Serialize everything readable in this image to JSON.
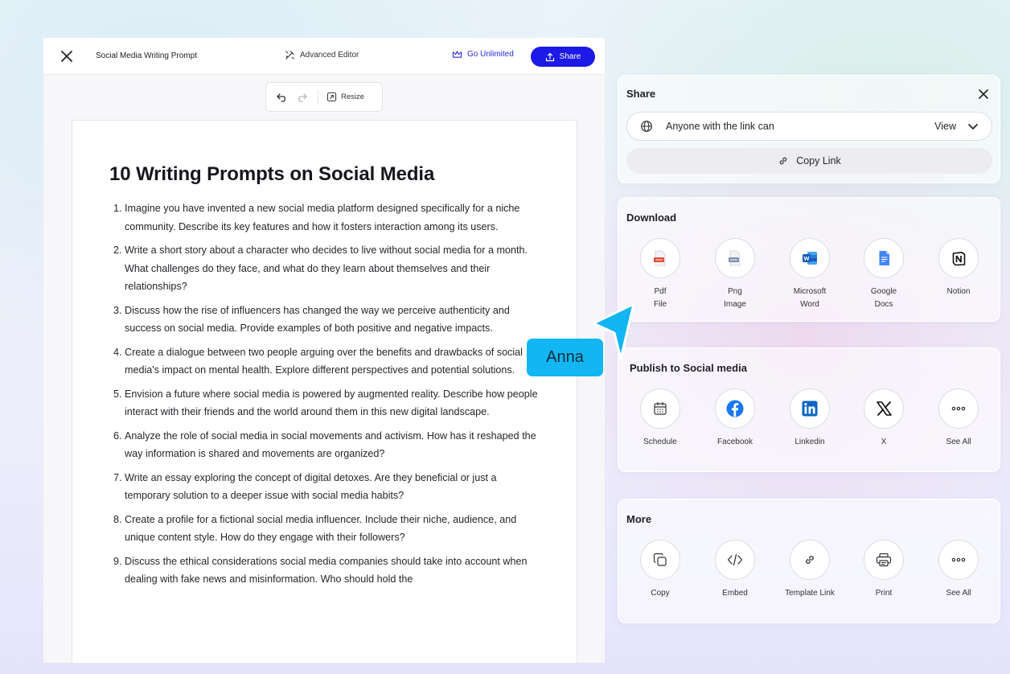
{
  "topbar": {
    "doc_title": "Social Media Writing Prompt",
    "advanced_editor": "Advanced Editor",
    "go_unlimited": "Go Unlimited",
    "share": "Share"
  },
  "toolbar": {
    "resize": "Resize"
  },
  "document": {
    "title": "10 Writing Prompts on Social Media",
    "prompts": [
      "Imagine you have invented a new social media platform designed specifically for a niche community. Describe its key features and how it fosters interaction among its users.",
      "Write a short story about a character who decides to live without social media for a month. What challenges do they face, and what do they learn about themselves and their relationships?",
      "Discuss how the rise of influencers has changed the way we perceive authenticity and success on social media. Provide examples of both positive and negative impacts.",
      "Create a dialogue between two people arguing over the benefits and drawbacks of social media's impact on mental health. Explore different perspectives and potential solutions.",
      "Envision a future where social media is powered by augmented reality. Describe how people interact with their friends and the world around them in this new digital landscape.",
      "Analyze the role of social media in social movements and activism. How has it reshaped the way information is shared and movements are organized?",
      "Write an essay exploring the concept of digital detoxes. Are they beneficial or just a temporary solution to a deeper issue with social media habits?",
      "Create a profile for a fictional social media influencer. Include their niche, audience, and unique content style. How do they engage with their followers?",
      "Discuss the ethical considerations social media companies should take into account when dealing with fake news and misinformation. Who should hold the"
    ]
  },
  "share_panel": {
    "title": "Share",
    "access_text": "Anyone with the link can",
    "access_level": "View",
    "copy_link": "Copy Link"
  },
  "download": {
    "title": "Download",
    "options": [
      {
        "label": "Pdf\nFile",
        "icon": "pdf-file-icon"
      },
      {
        "label": "Png\nImage",
        "icon": "png-image-icon"
      },
      {
        "label": "Microsoft\nWord",
        "icon": "microsoft-word-icon"
      },
      {
        "label": "Google\nDocs",
        "icon": "google-docs-icon"
      },
      {
        "label": "Notion",
        "icon": "notion-icon"
      }
    ]
  },
  "publish": {
    "title": "Publish to Social media",
    "options": [
      {
        "label": "Schedule",
        "icon": "calendar-icon"
      },
      {
        "label": "Facebook",
        "icon": "facebook-icon"
      },
      {
        "label": "Linkedin",
        "icon": "linkedin-icon"
      },
      {
        "label": "X",
        "icon": "x-logo-icon"
      },
      {
        "label": "See All",
        "icon": "more-dots-icon"
      }
    ]
  },
  "more": {
    "title": "More",
    "options": [
      {
        "label": "Copy",
        "icon": "copy-icon"
      },
      {
        "label": "Embed",
        "icon": "code-icon"
      },
      {
        "label": "Template Link",
        "icon": "link-icon"
      },
      {
        "label": "Print",
        "icon": "printer-icon"
      },
      {
        "label": "See All",
        "icon": "more-dots-icon"
      }
    ]
  },
  "collaborator": {
    "name": "Anna",
    "color": "#11b6f2"
  },
  "colors": {
    "primary": "#1d19e6",
    "facebook": "#1877f2",
    "linkedin": "#0a66c2",
    "word": "#185abd",
    "google_docs": "#4285f4",
    "pdf": "#e5493a"
  }
}
